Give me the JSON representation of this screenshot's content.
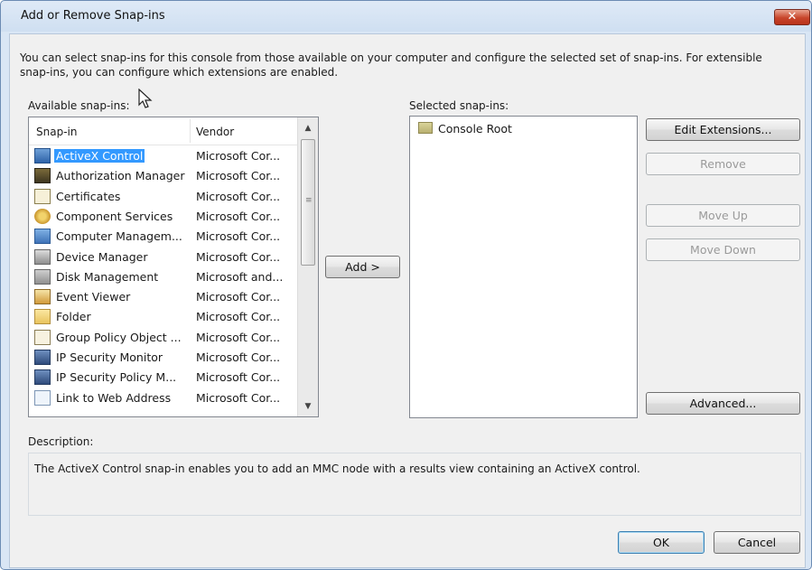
{
  "window": {
    "title": "Add or Remove Snap-ins",
    "close_label": "✕",
    "intro": "You can select snap-ins for this console from those available on your computer and configure the selected set of snap-ins. For extensible snap-ins, you can configure which extensions are enabled."
  },
  "available": {
    "label": "Available snap-ins:",
    "columns": [
      "Snap-in",
      "Vendor"
    ],
    "rows": [
      {
        "name": "ActiveX Control",
        "vendor": "Microsoft Cor...",
        "icon": "activex-icon",
        "selected": true
      },
      {
        "name": "Authorization Manager",
        "vendor": "Microsoft Cor...",
        "icon": "authorization-manager-icon"
      },
      {
        "name": "Certificates",
        "vendor": "Microsoft Cor...",
        "icon": "certificates-icon"
      },
      {
        "name": "Component Services",
        "vendor": "Microsoft Cor...",
        "icon": "component-services-icon"
      },
      {
        "name": "Computer Managem...",
        "vendor": "Microsoft Cor...",
        "icon": "computer-management-icon"
      },
      {
        "name": "Device Manager",
        "vendor": "Microsoft Cor...",
        "icon": "device-manager-icon"
      },
      {
        "name": "Disk Management",
        "vendor": "Microsoft and...",
        "icon": "disk-management-icon"
      },
      {
        "name": "Event Viewer",
        "vendor": "Microsoft Cor...",
        "icon": "event-viewer-icon"
      },
      {
        "name": "Folder",
        "vendor": "Microsoft Cor...",
        "icon": "folder-icon"
      },
      {
        "name": "Group Policy Object ...",
        "vendor": "Microsoft Cor...",
        "icon": "group-policy-icon"
      },
      {
        "name": "IP Security Monitor",
        "vendor": "Microsoft Cor...",
        "icon": "ip-security-monitor-icon"
      },
      {
        "name": "IP Security Policy M...",
        "vendor": "Microsoft Cor...",
        "icon": "ip-security-policy-icon"
      },
      {
        "name": "Link to Web Address",
        "vendor": "Microsoft Cor...",
        "icon": "link-web-address-icon"
      }
    ]
  },
  "add_button": "Add >",
  "selected": {
    "label": "Selected snap-ins:",
    "items": [
      {
        "name": "Console Root",
        "icon": "folder-icon"
      }
    ]
  },
  "side_buttons": {
    "edit_extensions": "Edit Extensions...",
    "remove": "Remove",
    "move_up": "Move Up",
    "move_down": "Move Down",
    "advanced": "Advanced..."
  },
  "description": {
    "label": "Description:",
    "text": "The ActiveX Control snap-in enables you to add an MMC node with a results view containing an ActiveX control."
  },
  "footer": {
    "ok": "OK",
    "cancel": "Cancel"
  },
  "colors": {
    "selection": "#3399ff",
    "close": "#c8452b"
  }
}
